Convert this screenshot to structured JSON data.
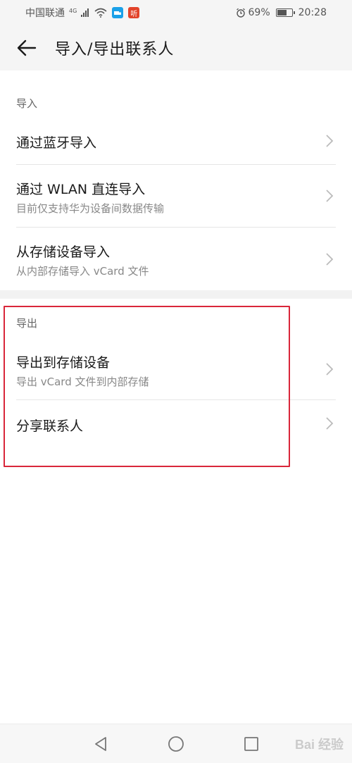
{
  "status_bar": {
    "carrier": "中国联通",
    "network_tag": "4G",
    "battery_percent": "69%",
    "battery_level": 0.69,
    "time": "20:28",
    "app_icon_1_color": "#1aa0e8",
    "app_icon_2_color": "#e2432a",
    "app_icon_2_text": "听"
  },
  "header": {
    "title": "导入/导出联系人"
  },
  "import_section": {
    "header": "导入",
    "items": [
      {
        "title": "通过蓝牙导入",
        "subtitle": ""
      },
      {
        "title": "通过 WLAN 直连导入",
        "subtitle": "目前仅支持华为设备间数据传输"
      },
      {
        "title": "从存储设备导入",
        "subtitle": "从内部存储导入 vCard 文件"
      }
    ]
  },
  "export_section": {
    "header": "导出",
    "items": [
      {
        "title": "导出到存储设备",
        "subtitle": "导出 vCard 文件到内部存储"
      },
      {
        "title": "分享联系人",
        "subtitle": ""
      }
    ]
  },
  "highlight_color": "#d9263a",
  "watermark": "Bai 经验"
}
